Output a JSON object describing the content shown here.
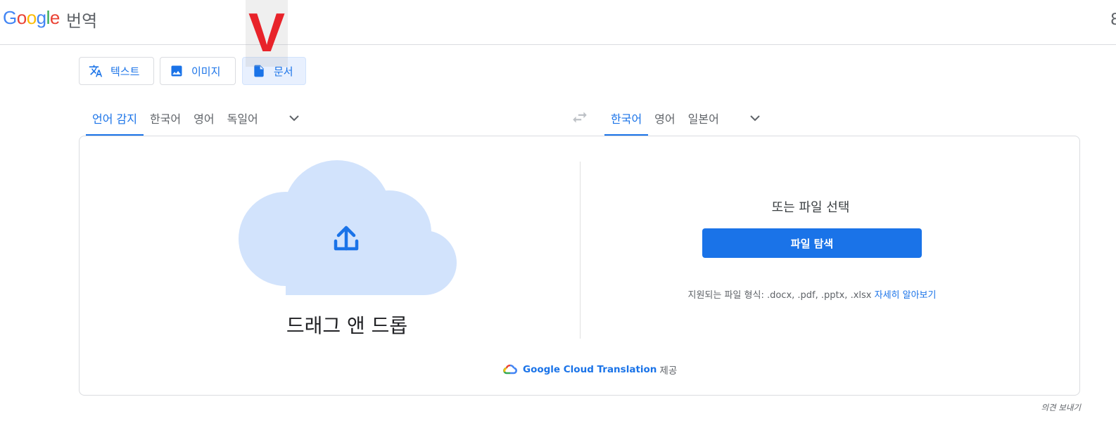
{
  "header": {
    "logo_letters": [
      "G",
      "o",
      "o",
      "g",
      "l",
      "e"
    ],
    "product_name": "번역",
    "top_right_glyph": "8"
  },
  "modes": [
    {
      "label": "텍스트",
      "icon": "translate-icon",
      "active": false
    },
    {
      "label": "이미지",
      "icon": "image-icon",
      "active": false
    },
    {
      "label": "문서",
      "icon": "document-icon",
      "active": true
    }
  ],
  "annotation_mark": "V",
  "source_langs": [
    {
      "label": "언어 감지",
      "active": true
    },
    {
      "label": "한국어",
      "active": false
    },
    {
      "label": "영어",
      "active": false
    },
    {
      "label": "독일어",
      "active": false
    }
  ],
  "target_langs": [
    {
      "label": "한국어",
      "active": true
    },
    {
      "label": "영어",
      "active": false
    },
    {
      "label": "일본어",
      "active": false
    }
  ],
  "upload": {
    "drop_text": "드래그 앤 드롭",
    "or_text": "또는 파일 선택",
    "browse_label": "파일 탐색",
    "formats_text": "지원되는 파일 형식: .docx, .pdf, .pptx, .xlsx",
    "learn_more": "자세히 알아보기"
  },
  "powered_by": {
    "service": "Google Cloud Translation",
    "suffix": "제공"
  },
  "footer": {
    "feedback": "의견 보내기"
  },
  "colors": {
    "accent": "#1a73e8",
    "cloud": "#d2e3fc",
    "annotation": "#e8232a"
  }
}
